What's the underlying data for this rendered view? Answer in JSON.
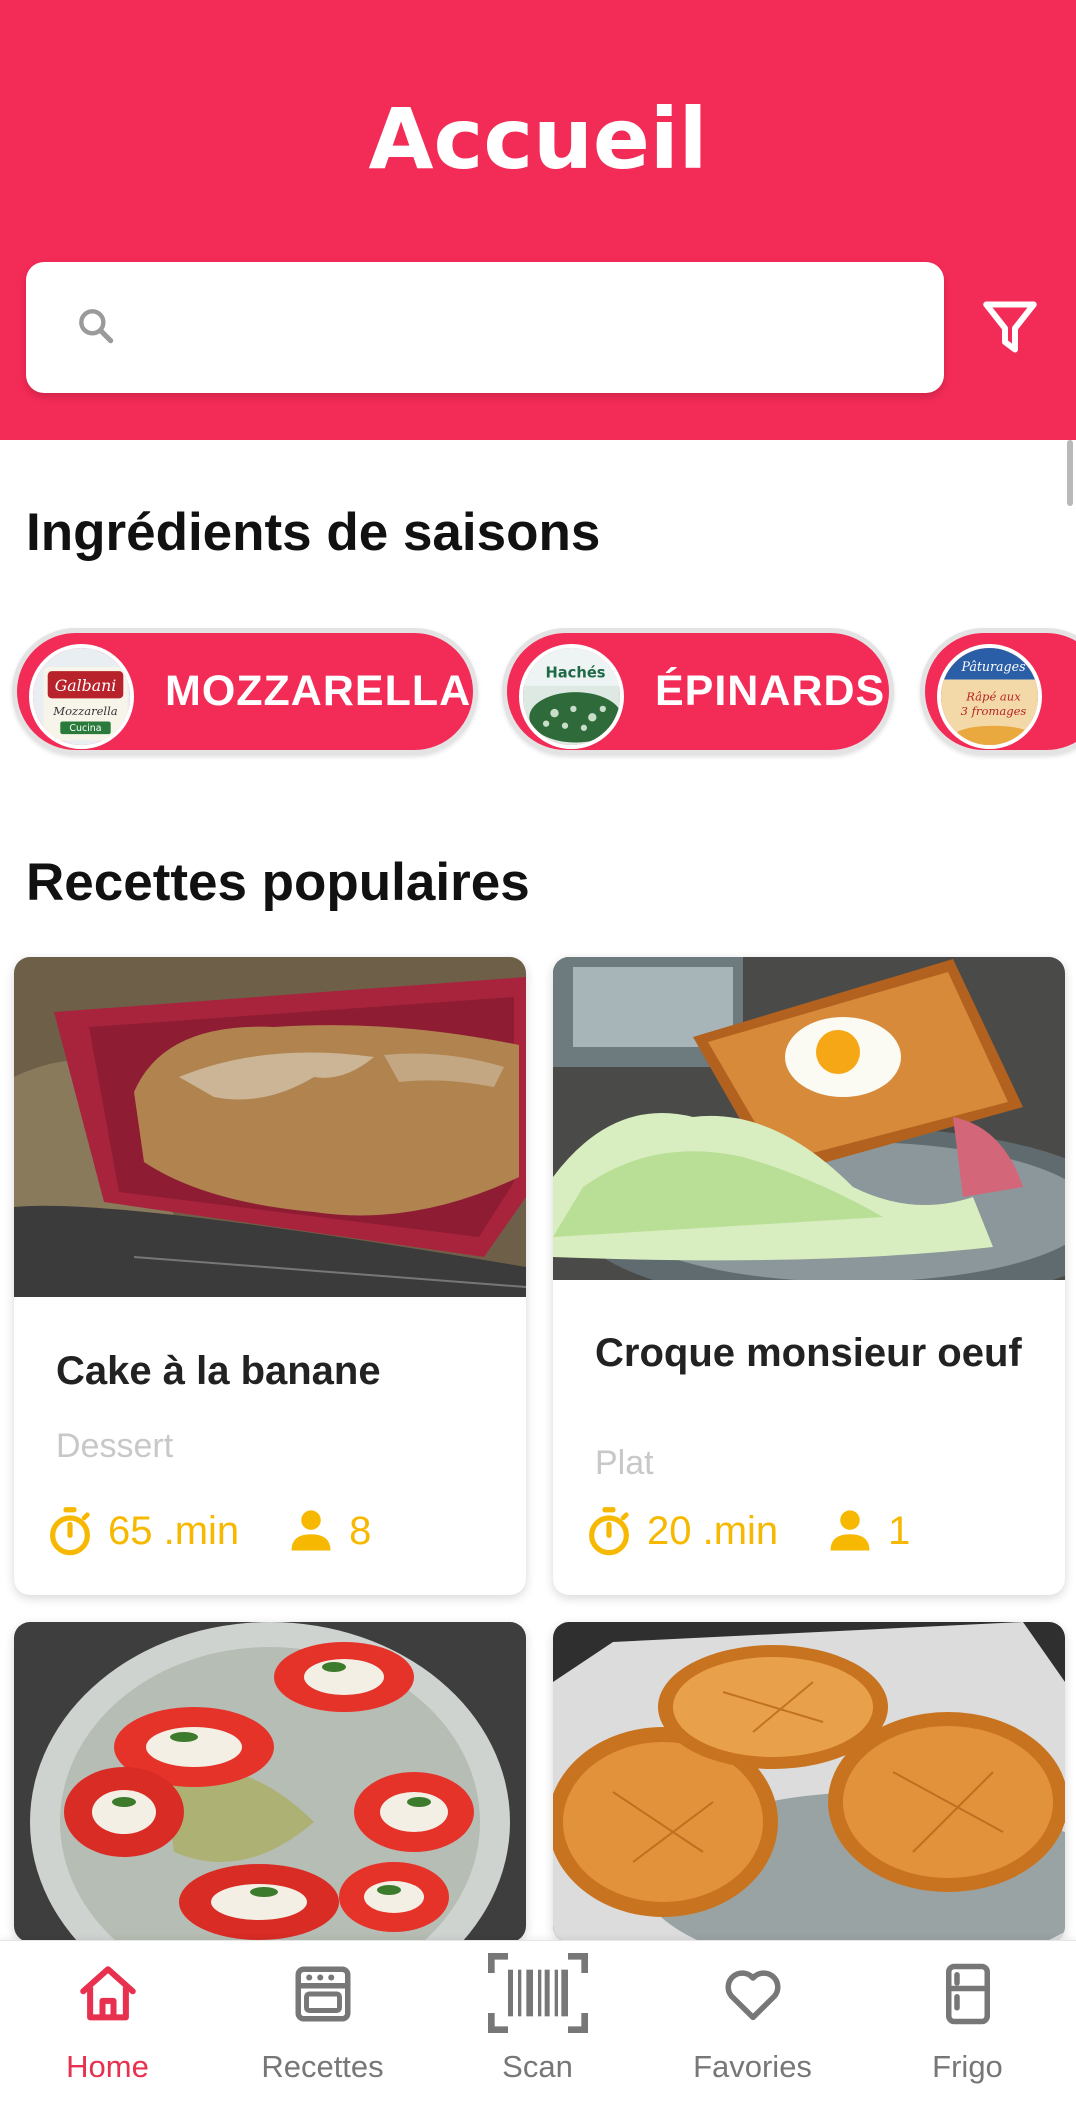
{
  "header": {
    "title": "Accueil",
    "search_placeholder": "",
    "accent_color": "#F32B57"
  },
  "seasonal": {
    "title": "Ingrédients de saisons",
    "chips": [
      {
        "label": "MOZZARELLA",
        "image": "mozzarella-package"
      },
      {
        "label": "ÉPINARDS",
        "image": "spinach-package"
      },
      {
        "label": "",
        "image": "grated-cheese-package"
      }
    ]
  },
  "popular": {
    "title": "Recettes populaires",
    "recipes": [
      {
        "title": "Cake à la banane",
        "category": "Dessert",
        "time": "65 .min",
        "servings": "8"
      },
      {
        "title": "Croque monsieur oeuf",
        "category": "Plat",
        "time": "20 .min",
        "servings": "1"
      },
      {
        "title": "",
        "category": "",
        "time": "",
        "servings": ""
      },
      {
        "title": "",
        "category": "",
        "time": "",
        "servings": ""
      }
    ],
    "meta_color": "#F6B800"
  },
  "nav": {
    "items": [
      {
        "label": "Home",
        "icon": "home-icon",
        "active": true
      },
      {
        "label": "Recettes",
        "icon": "oven-icon",
        "active": false
      },
      {
        "label": "Scan",
        "icon": "barcode-scan-icon",
        "active": false
      },
      {
        "label": "Favories",
        "icon": "heart-icon",
        "active": false
      },
      {
        "label": "Frigo",
        "icon": "fridge-icon",
        "active": false
      }
    ]
  }
}
